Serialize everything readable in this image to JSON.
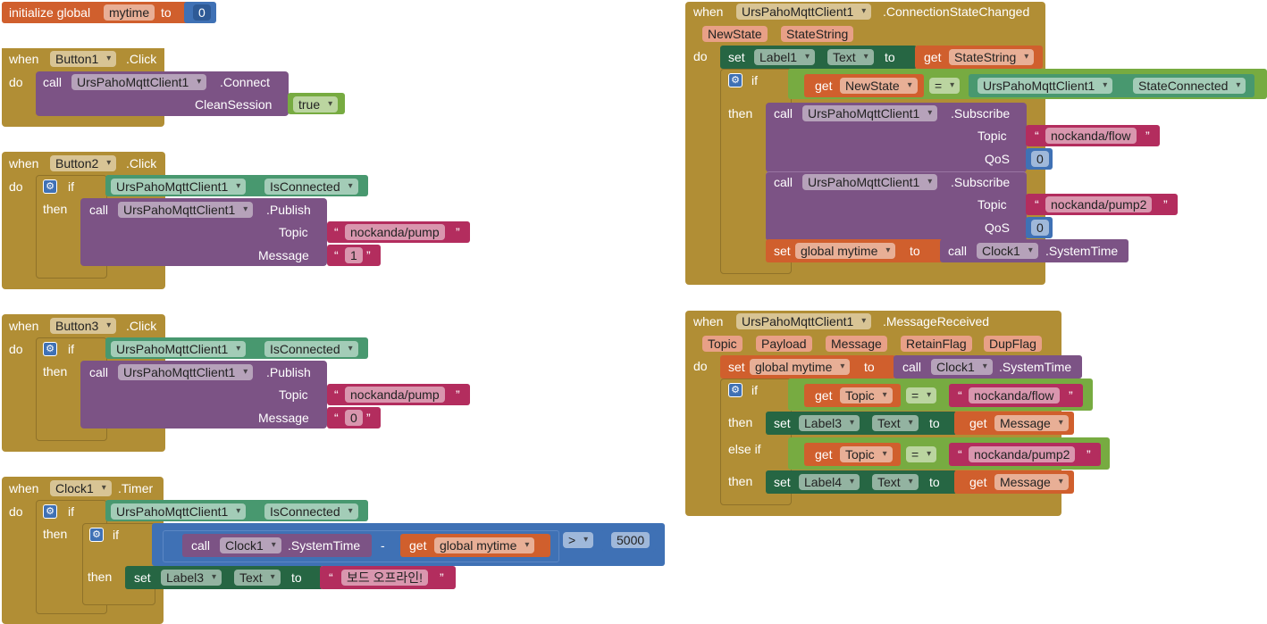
{
  "init": {
    "kw1": "initialize global",
    "name": "mytime",
    "kw2": "to",
    "value": "0"
  },
  "b1": {
    "when": "when",
    "comp": "Button1",
    "event": ".Click",
    "do": "do",
    "call": "call",
    "mcomp": "UrsPahoMqttClient1",
    "method": ".Connect",
    "param": "CleanSession",
    "val": "true"
  },
  "b2": {
    "when": "when",
    "comp": "Button2",
    "event": ".Click",
    "do": "do",
    "if": "if",
    "then": "then",
    "cond_comp": "UrsPahoMqttClient1",
    "cond_prop": "IsConnected",
    "call": "call",
    "mcomp": "UrsPahoMqttClient1",
    "method": ".Publish",
    "topic_label": "Topic",
    "topic": "nockanda/pump",
    "msg_label": "Message",
    "msg": "1"
  },
  "b3": {
    "when": "when",
    "comp": "Button3",
    "event": ".Click",
    "do": "do",
    "if": "if",
    "then": "then",
    "cond_comp": "UrsPahoMqttClient1",
    "cond_prop": "IsConnected",
    "call": "call",
    "mcomp": "UrsPahoMqttClient1",
    "method": ".Publish",
    "topic_label": "Topic",
    "topic": "nockanda/pump",
    "msg_label": "Message",
    "msg": "0"
  },
  "b4": {
    "when": "when",
    "comp": "Clock1",
    "event": ".Timer",
    "do": "do",
    "if": "if",
    "then": "then",
    "cond_comp": "UrsPahoMqttClient1",
    "cond_prop": "IsConnected",
    "if2": "if",
    "then2": "then",
    "call": "call",
    "ccomp": "Clock1",
    "cmethod": ".SystemTime",
    "minus": "-",
    "get": "get",
    "gvar": "global mytime",
    "op": ">",
    "num": "5000",
    "set": "set",
    "scomp": "Label3",
    "sprop": "Text",
    "to": "to",
    "stext": "보드 오프라인!"
  },
  "b5": {
    "when": "when",
    "comp": "UrsPahoMqttClient1",
    "event": ".ConnectionStateChanged",
    "p1": "NewState",
    "p2": "StateString",
    "do": "do",
    "set": "set",
    "scomp": "Label1",
    "sprop": "Text",
    "to": "to",
    "get": "get",
    "gvar": "StateString",
    "if": "if",
    "then": "then",
    "get2": "get",
    "gvar2": "NewState",
    "eq": "=",
    "ecomp": "UrsPahoMqttClient1",
    "eprop": "StateConnected",
    "call": "call",
    "mcomp": "UrsPahoMqttClient1",
    "method": ".Subscribe",
    "topic_label": "Topic",
    "topic1": "nockanda/flow",
    "qos_label": "QoS",
    "qos1": "0",
    "topic2": "nockanda/pump2",
    "qos2": "0",
    "set2": "set",
    "gset": "global mytime",
    "to2": "to",
    "call2": "call",
    "ccomp": "Clock1",
    "cmethod": ".SystemTime"
  },
  "b6": {
    "when": "when",
    "comp": "UrsPahoMqttClient1",
    "event": ".MessageReceived",
    "p1": "Topic",
    "p2": "Payload",
    "p3": "Message",
    "p4": "RetainFlag",
    "p5": "DupFlag",
    "do": "do",
    "set": "set",
    "gset": "global mytime",
    "to": "to",
    "call": "call",
    "ccomp": "Clock1",
    "cmethod": ".SystemTime",
    "if": "if",
    "then": "then",
    "elseif": "else if",
    "then2": "then",
    "get": "get",
    "gv": "Topic",
    "eq": "=",
    "t1": "nockanda/flow",
    "t2": "nockanda/pump2",
    "set1": "set",
    "l1": "Label3",
    "prop": "Text",
    "to1": "to",
    "get1": "get",
    "gm": "Message",
    "l2": "Label4"
  }
}
